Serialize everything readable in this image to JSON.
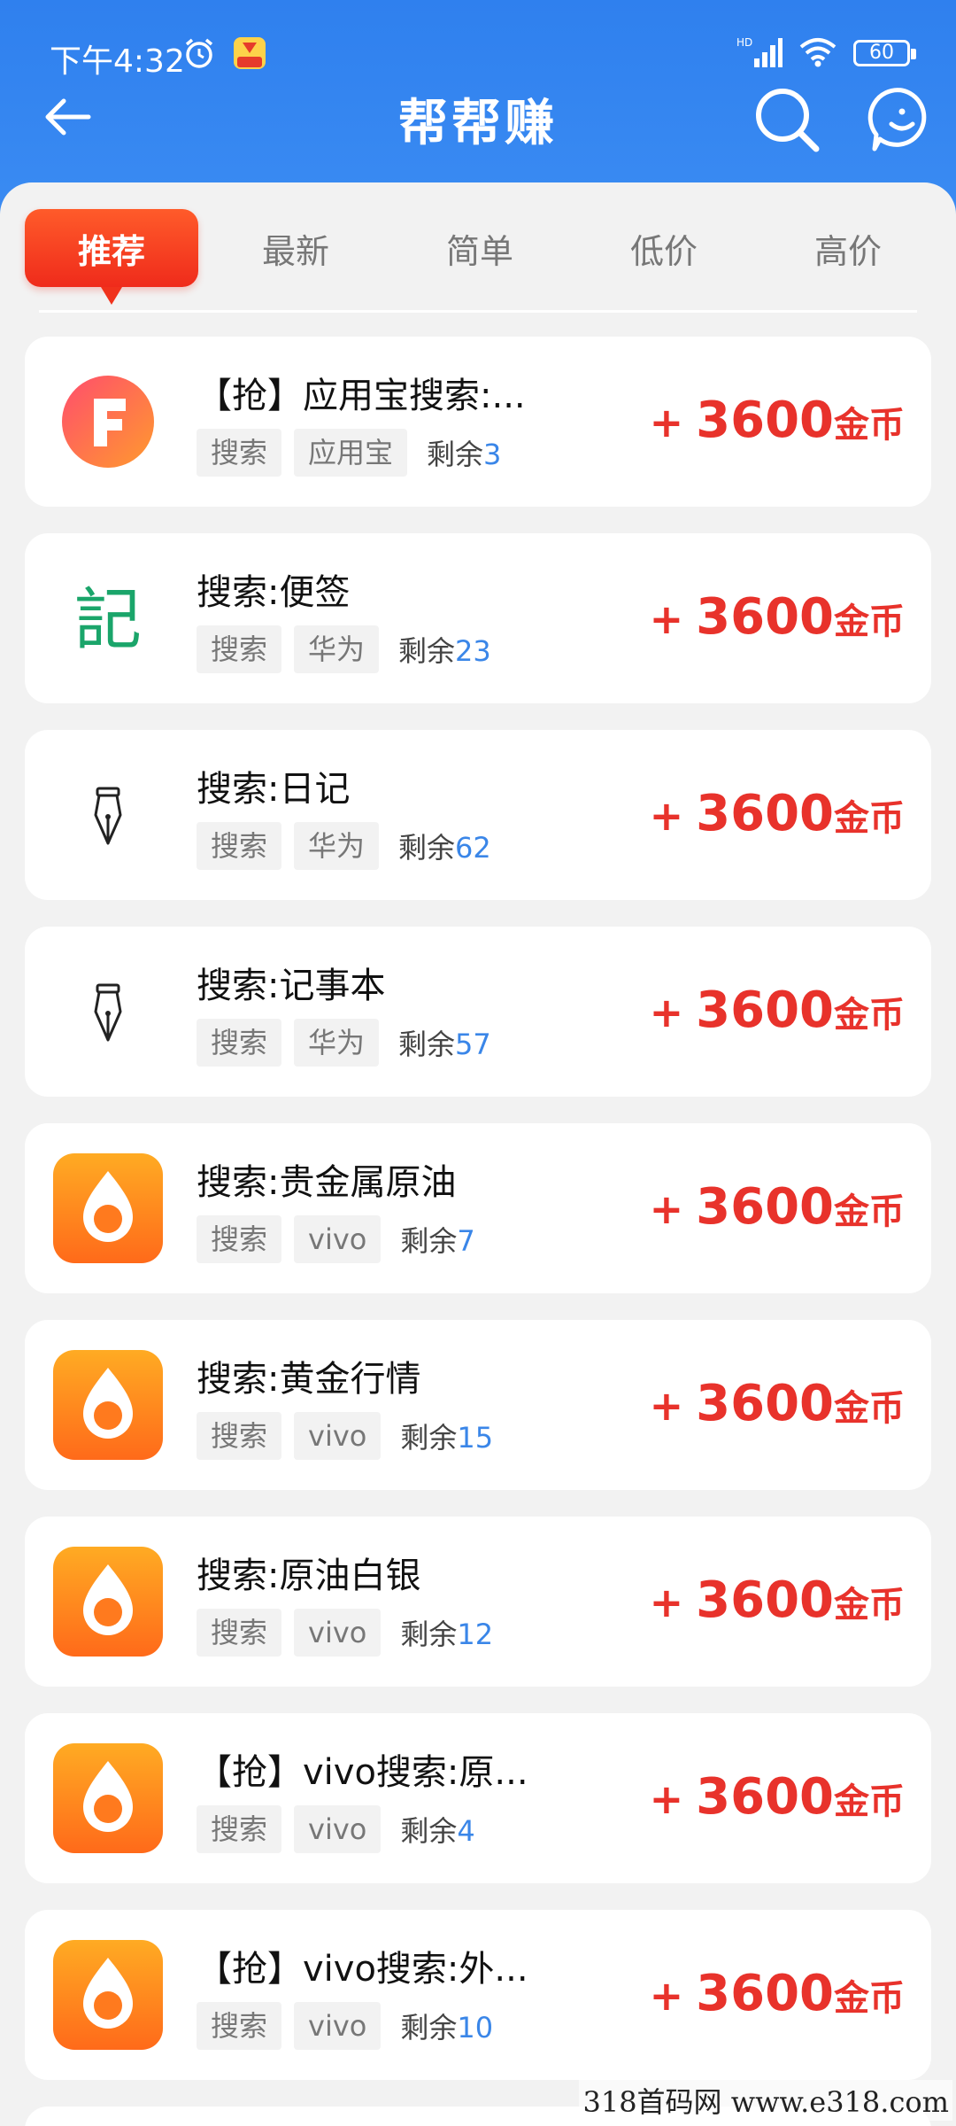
{
  "status_bar": {
    "time": "下午4:32",
    "network": "HD",
    "battery": "60"
  },
  "nav": {
    "title": "帮帮赚"
  },
  "tabs": [
    {
      "label": "推荐",
      "active": true
    },
    {
      "label": "最新",
      "active": false
    },
    {
      "label": "简单",
      "active": false
    },
    {
      "label": "低价",
      "active": false
    },
    {
      "label": "高价",
      "active": false
    }
  ],
  "reward_plus": "+",
  "reward_unit": "金币",
  "remain_label": "剩余",
  "tasks": [
    {
      "icon": "app-store-f-icon",
      "title": "【抢】应用宝搜索:...",
      "tags": [
        "搜索",
        "应用宝"
      ],
      "remain": "3",
      "reward": "3600"
    },
    {
      "icon": "notes-ji-icon",
      "title": "搜索:便签",
      "tags": [
        "搜索",
        "华为"
      ],
      "remain": "23",
      "reward": "3600"
    },
    {
      "icon": "pen-nib-icon",
      "title": "搜索:日记",
      "tags": [
        "搜索",
        "华为"
      ],
      "remain": "62",
      "reward": "3600"
    },
    {
      "icon": "pen-nib-icon",
      "title": "搜索:记事本",
      "tags": [
        "搜索",
        "华为"
      ],
      "remain": "57",
      "reward": "3600"
    },
    {
      "icon": "oil-drop-icon",
      "title": "搜索:贵金属原油",
      "tags": [
        "搜索",
        "vivo"
      ],
      "remain": "7",
      "reward": "3600"
    },
    {
      "icon": "oil-drop-icon",
      "title": "搜索:黄金行情",
      "tags": [
        "搜索",
        "vivo"
      ],
      "remain": "15",
      "reward": "3600"
    },
    {
      "icon": "oil-drop-icon",
      "title": "搜索:原油白银",
      "tags": [
        "搜索",
        "vivo"
      ],
      "remain": "12",
      "reward": "3600"
    },
    {
      "icon": "oil-drop-icon",
      "title": "【抢】vivo搜索:原...",
      "tags": [
        "搜索",
        "vivo"
      ],
      "remain": "4",
      "reward": "3600"
    },
    {
      "icon": "oil-drop-icon",
      "title": "【抢】vivo搜索:外...",
      "tags": [
        "搜索",
        "vivo"
      ],
      "remain": "10",
      "reward": "3600"
    }
  ],
  "colors": {
    "header_blue": "#2f80ee",
    "active_tab_red": "#ef2b1b",
    "reward_red": "#e8322b",
    "remain_blue": "#3a86e8"
  },
  "watermark": "318首码网  www.e318.com"
}
